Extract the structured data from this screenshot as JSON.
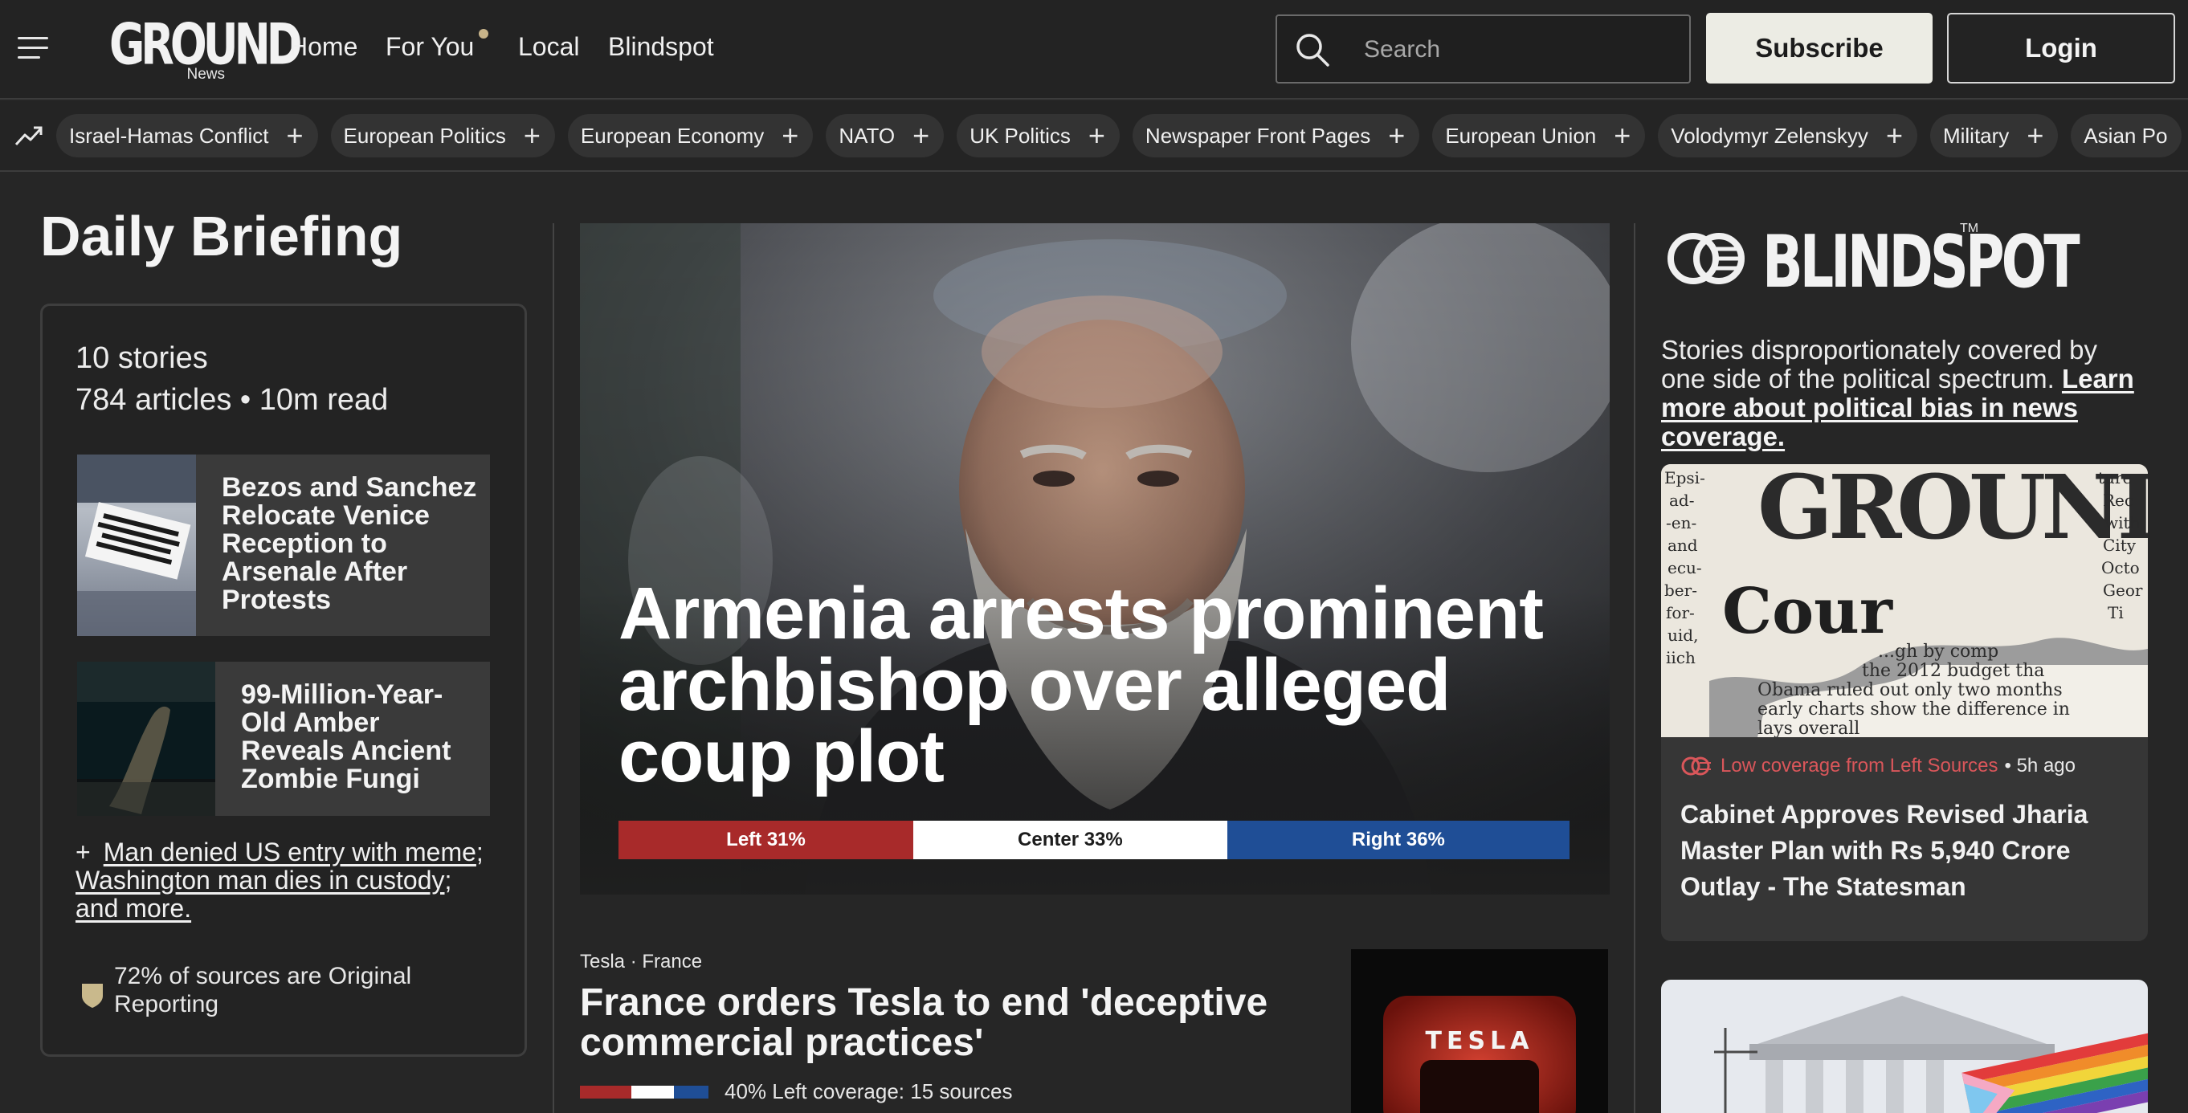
{
  "nav": {
    "logo_text": "GROUND",
    "logo_sub": "News",
    "links": [
      "Home",
      "For You",
      "Local",
      "Blindspot"
    ],
    "search_placeholder": "Search",
    "subscribe": "Subscribe",
    "login": "Login"
  },
  "topics": [
    "Israel-Hamas Conflict",
    "European Politics",
    "European Economy",
    "NATO",
    "UK Politics",
    "Newspaper Front Pages",
    "European Union",
    "Volodymyr Zelenskyy",
    "Military",
    "Asian Po"
  ],
  "briefing": {
    "title": "Daily Briefing",
    "stories": "10 stories",
    "articles": "784 articles • 10m read",
    "story1": "Bezos and Sanchez Relocate Venice Reception to Arsenale After Protests",
    "story2": "99-Million-Year-Old Amber Reveals Ancient Zombie Fungi",
    "more_plus": "+",
    "more1": "Man denied US entry with meme",
    "more2": "Washington man dies in custody",
    "more3": "and more.",
    "original": "72% of sources are Original Reporting"
  },
  "hero": {
    "title": "Armenia arrests prominent archbishop over alleged coup plot",
    "left_label": "Left 31%",
    "center_label": "Center 33%",
    "right_label": "Right 36%",
    "left_pct": 31,
    "center_pct": 33,
    "right_pct": 36
  },
  "second": {
    "meta": "Tesla · France",
    "title": "France orders Tesla to end 'deceptive commercial practices'",
    "coverage": "40% Left coverage: 15 sources",
    "bar_left_pct": 40,
    "bar_center_pct": 33,
    "bar_right_pct": 27,
    "img_text": "TESLA"
  },
  "blindspot": {
    "logo": "BLINDSPOT",
    "tm": "TM",
    "desc": "Stories disproportionately covered by one side of the political spectrum.",
    "link": "Learn more about political bias in news coverage.",
    "card_meta_coverage": "Low coverage from Left Sources",
    "card_meta_time": "• 5h ago",
    "card_title": "Cabinet Approves Revised Jharia Master Plan with Rs 5,940 Crore Outlay - The Statesman",
    "clip_mast": "GROUND",
    "clip_word": "Cour",
    "clip_lines": [
      "...gh by comp",
      "the 2012 budget tha",
      "Obama ruled out only two months",
      "early charts show the difference in",
      "lays overall"
    ]
  },
  "colors": {
    "left": "#a82a2a",
    "center": "#ffffff",
    "right": "#1f4e96",
    "low_coverage": "#d9565a"
  }
}
